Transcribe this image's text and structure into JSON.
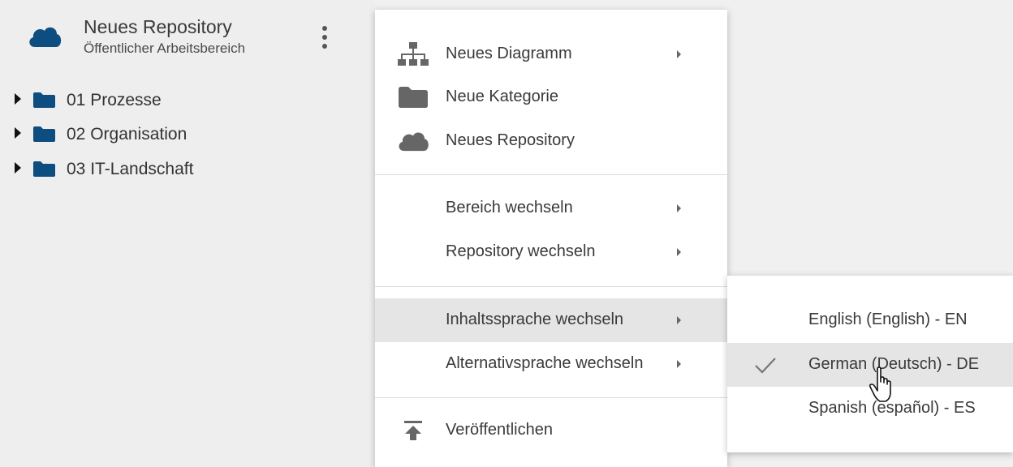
{
  "repository": {
    "title": "Neues Repository",
    "subtitle": "Öffentlicher Arbeitsbereich",
    "icon": "cloud-icon",
    "menu_icon": "more-vert-icon"
  },
  "tree": [
    {
      "label": "01 Prozesse",
      "icon": "folder-icon"
    },
    {
      "label": "02 Organisation",
      "icon": "folder-icon"
    },
    {
      "label": "03 IT-Landschaft",
      "icon": "folder-icon"
    }
  ],
  "context_menu": {
    "items": [
      {
        "label": "Neues Diagramm",
        "icon": "sitemap-icon",
        "has_submenu": true
      },
      {
        "label": "Neue Kategorie",
        "icon": "folder-icon",
        "has_submenu": false
      },
      {
        "label": "Neues Repository",
        "icon": "cloud-icon",
        "has_submenu": false
      },
      {
        "label": "Bereich wechseln",
        "icon": "",
        "has_submenu": true
      },
      {
        "label": "Repository wechseln",
        "icon": "",
        "has_submenu": true
      },
      {
        "label": "Inhaltssprache wechseln",
        "icon": "",
        "has_submenu": true,
        "active": true
      },
      {
        "label": "Alternativsprache wechseln",
        "icon": "",
        "has_submenu": true
      },
      {
        "label": "Veröffentlichen",
        "icon": "publish-icon",
        "has_submenu": false
      }
    ]
  },
  "language_submenu": {
    "items": [
      {
        "label": "English (English) - EN",
        "checked": false
      },
      {
        "label": "German (Deutsch) - DE",
        "checked": true
      },
      {
        "label": "Spanish (español) - ES",
        "checked": false
      }
    ]
  },
  "colors": {
    "accent": "#0d4d80",
    "menu_hover": "#e5e5e5",
    "icon_gray": "#666666"
  }
}
